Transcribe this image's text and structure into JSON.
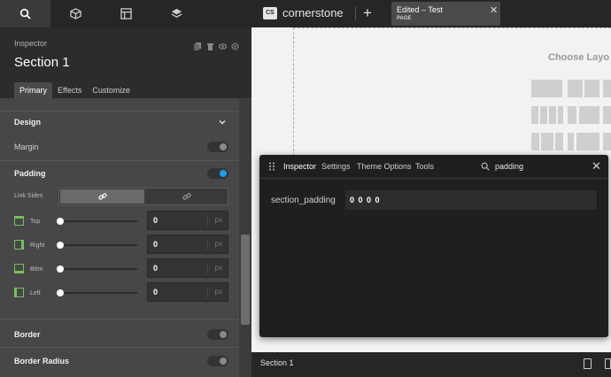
{
  "left_panel": {
    "icon_tabs": [
      "search-icon",
      "cube-icon",
      "layout-icon",
      "layers-icon"
    ],
    "inspector_label": "Inspector",
    "header_actions": [
      "copy-icon",
      "delete-icon",
      "eye-icon",
      "gear-icon"
    ],
    "section_title": "Section 1",
    "tabs": [
      "Primary",
      "Effects",
      "Customize"
    ],
    "active_tab": "Primary",
    "design_heading": "Design",
    "margin_label": "Margin",
    "margin_enabled": false,
    "padding_label": "Padding",
    "padding_enabled": true,
    "link_sides_label": "Link Sides",
    "sides": [
      {
        "label": "Top",
        "value": "0",
        "unit": "px"
      },
      {
        "label": "Right",
        "value": "0",
        "unit": "px"
      },
      {
        "label": "Bttm",
        "value": "0",
        "unit": "px"
      },
      {
        "label": "Left",
        "value": "0",
        "unit": "px"
      }
    ],
    "border_label": "Border",
    "border_enabled": false,
    "border_radius_label": "Border Radius",
    "border_radius_enabled": false
  },
  "topbar": {
    "logo_text": "CS",
    "app_name": "cornerstone",
    "doc_title": "Edited – Test",
    "doc_type": "PAGE"
  },
  "canvas": {
    "choose_layout_label": "Choose Layo"
  },
  "floating_inspector": {
    "tabs": [
      "Inspector",
      "Settings",
      "Theme Options",
      "Tools"
    ],
    "active_tab": "Inspector",
    "search_value": "padding",
    "property_name": "section_padding",
    "property_value": "0 0 0 0"
  },
  "bottom_bar": {
    "label": "Section 1"
  },
  "colors": {
    "accent_blue": "#1e9bf0",
    "side_icon_green": "#72c15a"
  }
}
